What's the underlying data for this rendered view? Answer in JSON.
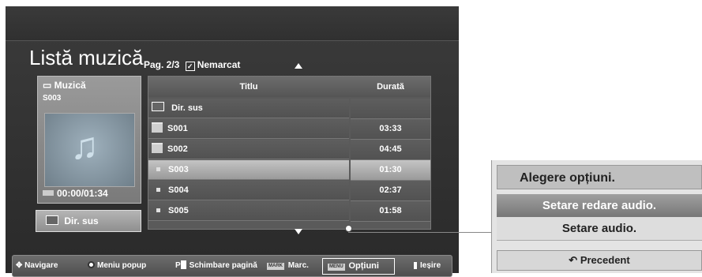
{
  "header": {
    "title": "Listă muzică",
    "page_info": "Pag. 2/3",
    "checkbox_label": "Nemarcat"
  },
  "info_panel": {
    "folder": "Muzică",
    "file": "S003",
    "time": "00:00/01:34",
    "dir_button": "Dir. sus"
  },
  "table": {
    "columns": [
      "Titlu",
      "Durată"
    ],
    "rows": [
      {
        "name": "Dir. sus",
        "duration": "",
        "icon": "up-folder-icon"
      },
      {
        "name": "S001",
        "duration": "03:33",
        "icon": "folder-icon"
      },
      {
        "name": "S002",
        "duration": "04:45",
        "icon": "folder-icon"
      },
      {
        "name": "S003",
        "duration": "01:30",
        "icon": "music-file-icon",
        "selected": true
      },
      {
        "name": "S004",
        "duration": "02:37",
        "icon": "music-file-icon"
      },
      {
        "name": "S005",
        "duration": "01:58",
        "icon": "music-file-icon"
      }
    ]
  },
  "bottom_bar": {
    "navigate": "Navigare",
    "popup_menu": "Meniu popup",
    "page_change": "Schimbare pagină",
    "mark": "Marc.",
    "mark_tag": "MARK",
    "options": "Opțiuni",
    "options_tag": "MENU",
    "exit": "Ieșire",
    "p_prefix": "P"
  },
  "options_popup": {
    "title": "Alegere opțiuni.",
    "items": [
      "Setare redare audio.",
      "Setare audio."
    ],
    "back": "Precedent"
  }
}
